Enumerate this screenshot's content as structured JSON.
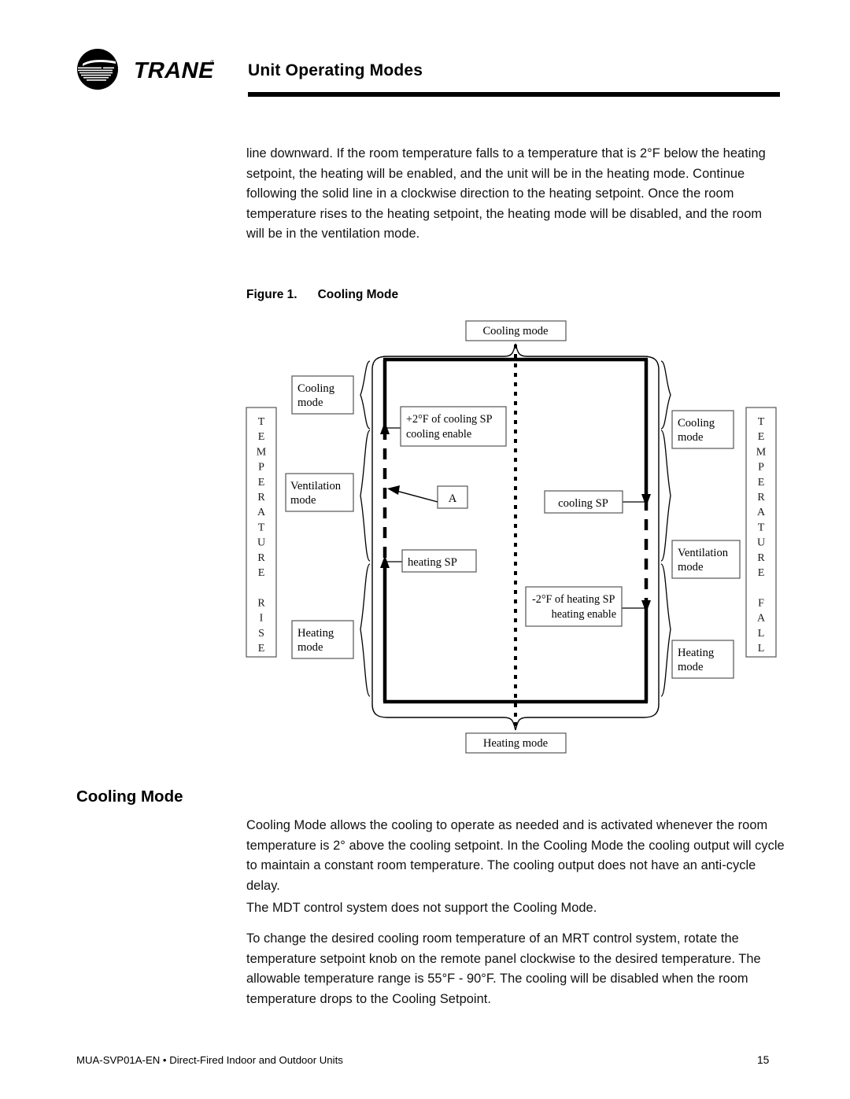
{
  "header": {
    "logo_alt": "TRANE",
    "title": "Unit Operating Modes"
  },
  "body": {
    "intro_paragraph": "line downward. If the room temperature falls to a temperature that is 2°F below the heating setpoint, the heating will be enabled, and the unit will be in the heating mode. Continue following the solid line in a clockwise direction to the heating setpoint. Once the room temperature rises to the heating setpoint, the heating mode will be disabled, and the room will be in the ventilation mode."
  },
  "figure": {
    "caption_label": "Figure 1.",
    "caption_title": "Cooling Mode",
    "top_label": "Cooling mode",
    "bottom_label": "Heating mode",
    "left_axis_letters": [
      "T",
      "E",
      "M",
      "P",
      "E",
      "R",
      "A",
      "T",
      "U",
      "R",
      "E",
      "",
      "R",
      "I",
      "S",
      "E"
    ],
    "right_axis_letters": [
      "T",
      "E",
      "M",
      "P",
      "E",
      "R",
      "A",
      "T",
      "U",
      "R",
      "E",
      "",
      "F",
      "A",
      "L",
      "L"
    ],
    "left_boxes": [
      {
        "name": "cooling-mode",
        "line1": "Cooling",
        "line2": "mode"
      },
      {
        "name": "ventilation-mode",
        "line1": "Ventilation",
        "line2": "mode"
      },
      {
        "name": "heating-mode",
        "line1": "Heating",
        "line2": "mode"
      }
    ],
    "right_boxes": [
      {
        "name": "cooling-mode",
        "line1": "Cooling",
        "line2": "mode"
      },
      {
        "name": "ventilation-mode",
        "line1": "Ventilation",
        "line2": "mode"
      },
      {
        "name": "heating-mode",
        "line1": "Heating",
        "line2": "mode"
      }
    ],
    "setpoint_labels": {
      "cooling_enable_line1": "+2°F of cooling SP",
      "cooling_enable_line2": "cooling enable",
      "heating_sp": "heating SP",
      "cooling_sp": "cooling SP",
      "heating_enable_line1": "-2°F of heating SP",
      "heating_enable_line2": "heating enable",
      "callout_a": "A"
    }
  },
  "section": {
    "heading": "Cooling Mode",
    "paragraph_1": "Cooling Mode allows the cooling to operate as needed and is activated whenever the room temperature is 2° above the cooling setpoint. In the Cooling Mode the cooling output will cycle to maintain a constant room temperature. The cooling output does not have an anti-cycle delay.",
    "paragraph_2": "The MDT control system does not support the Cooling Mode.",
    "paragraph_3": "To change the desired cooling room temperature of an MRT control system, rotate the temperature setpoint knob on the remote panel clockwise to the desired temperature. The allowable temperature range is 55°F - 90°F. The cooling will be disabled when the room temperature drops to the Cooling Setpoint."
  },
  "footer": {
    "document_id": "MUA-SVP01A-EN • Direct-Fired Indoor and Outdoor Units",
    "page_number": "15"
  },
  "colors": {
    "ink": "#000000",
    "box_stroke": "#555555"
  }
}
